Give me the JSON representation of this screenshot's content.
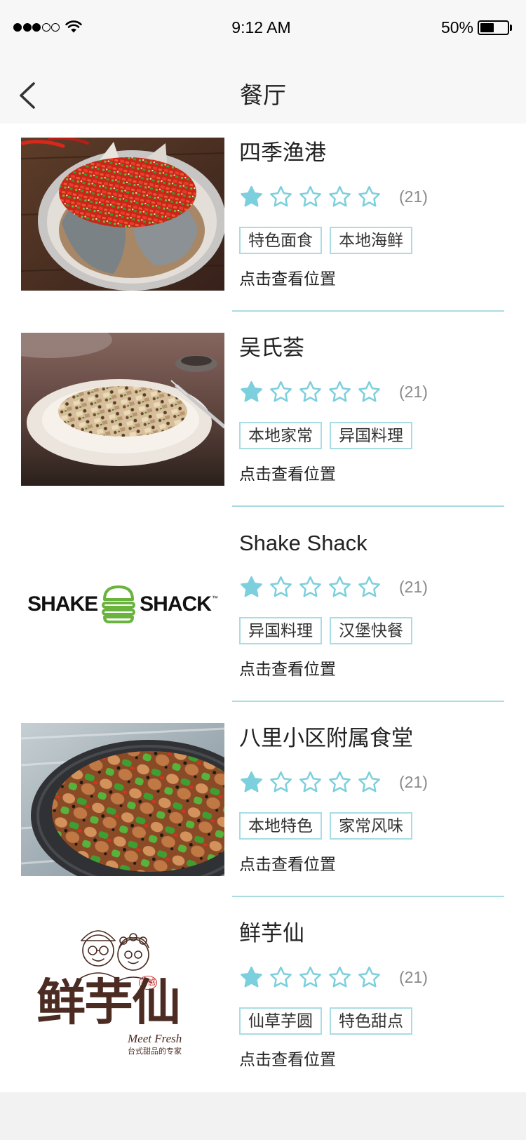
{
  "status_bar": {
    "time": "9:12 AM",
    "battery_percent": "50%",
    "battery_level": 0.5,
    "signal_strength": 3,
    "signal_max": 5,
    "icons": [
      "signal-icon",
      "wifi-icon",
      "battery-icon"
    ]
  },
  "nav": {
    "title": "餐厅",
    "back_icon": "chevron-left-icon"
  },
  "colors": {
    "accent": "#7ccfdc",
    "tag_border": "#a8dde4",
    "divider": "#a9dce3",
    "header_bg": "#f7f7f7",
    "footer_bg": "#f2f2f2",
    "text": "#222222",
    "muted": "#8a8a8a"
  },
  "restaurants": [
    {
      "name": "四季渔港",
      "rating": 1,
      "rating_max": 5,
      "star_icon": "star-icon",
      "review_count": "(21)",
      "tags": [
        "特色面食",
        "本地海鲜"
      ],
      "location_link": "点击查看位置"
    },
    {
      "name": "吴氏荟",
      "rating": 1,
      "rating_max": 5,
      "star_icon": "star-icon",
      "review_count": "(21)",
      "tags": [
        "本地家常",
        "异国料理"
      ],
      "location_link": "点击查看位置"
    },
    {
      "name": "Shake Shack",
      "rating": 1,
      "rating_max": 5,
      "star_icon": "star-icon",
      "review_count": "(21)",
      "tags": [
        "异国料理",
        "汉堡快餐"
      ],
      "location_link": "点击查看位置",
      "logo": {
        "left_word": "SHAKE",
        "right_word": "SHACK",
        "trademark": "™",
        "icon": "burger-icon",
        "color": "#6ab43e"
      }
    },
    {
      "name": "八里小区附属食堂",
      "rating": 1,
      "rating_max": 5,
      "star_icon": "star-icon",
      "review_count": "(21)",
      "tags": [
        "本地特色",
        "家常风味"
      ],
      "location_link": "点击查看位置"
    },
    {
      "name": "鲜芋仙",
      "rating": 1,
      "rating_max": 5,
      "star_icon": "star-icon",
      "review_count": "(21)",
      "tags": [
        "仙草芋圆",
        "特色甜点"
      ],
      "location_link": "点击查看位置",
      "logo": {
        "title": "鲜芋仙",
        "seal": "手感",
        "english": "Meet Fresh",
        "slogan": "台式甜品的专家",
        "color": "#4b2b22"
      }
    }
  ]
}
